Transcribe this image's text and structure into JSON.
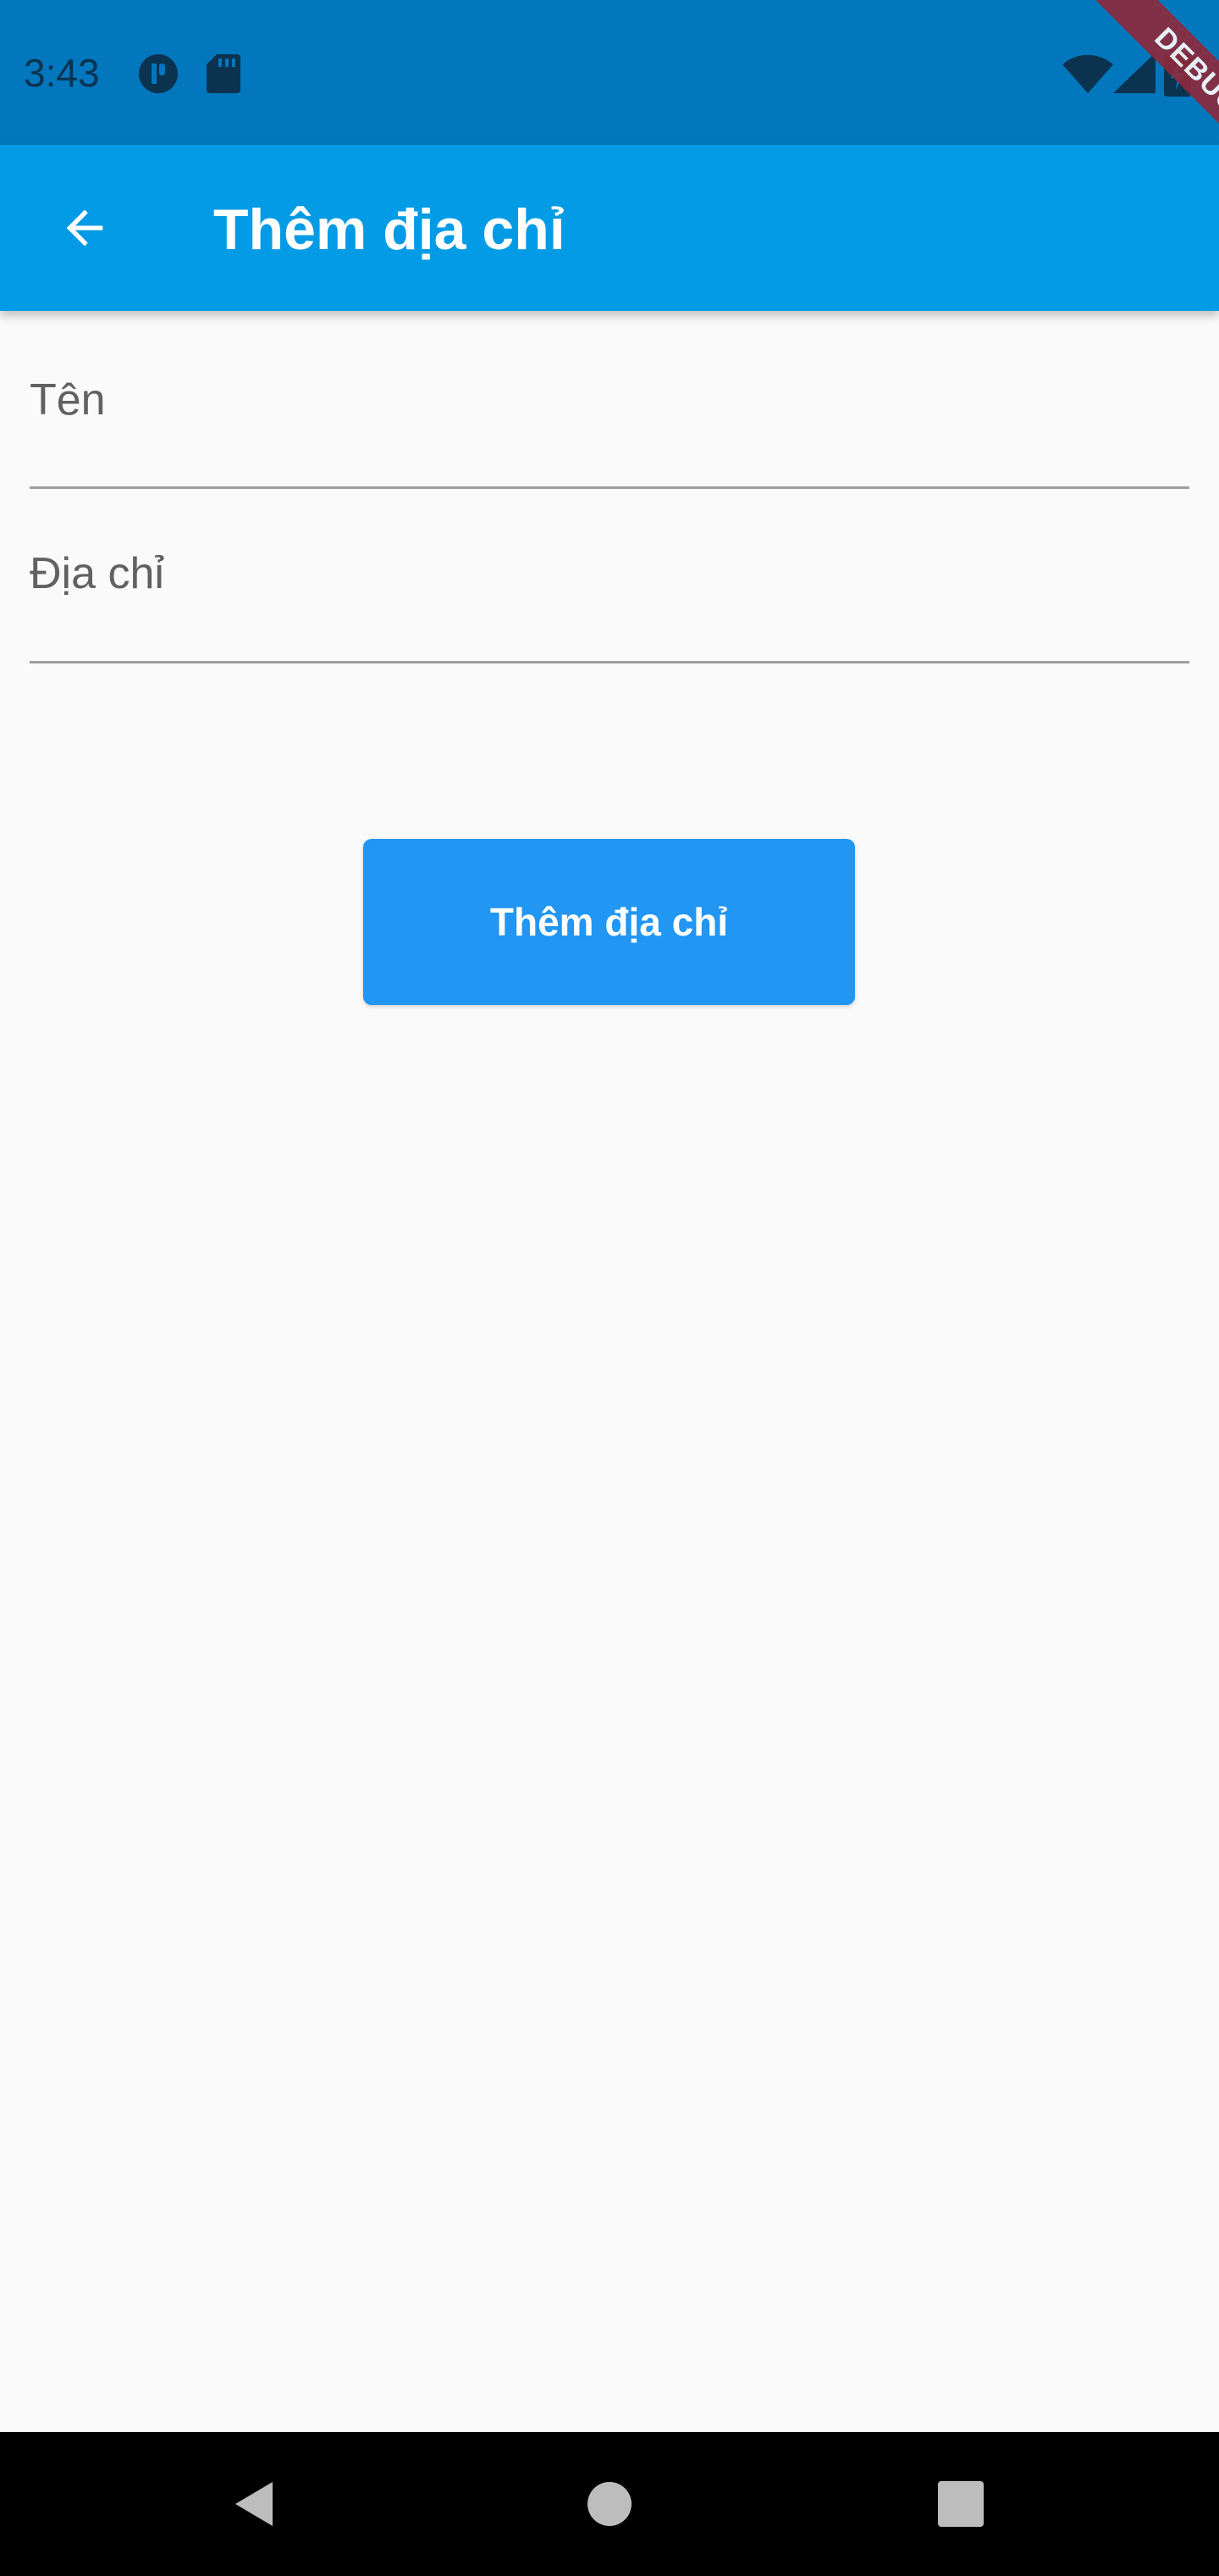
{
  "status_bar": {
    "time": "3:43",
    "icons": [
      "app-notification-icon",
      "sd-card-icon",
      "wifi-icon",
      "signal-icon",
      "battery-charging-icon"
    ]
  },
  "debug_banner": {
    "label": "DEBUG"
  },
  "app_bar": {
    "back_icon": "arrow-back-icon",
    "title": "Thêm địa chỉ"
  },
  "form": {
    "name_field": {
      "label": "Tên",
      "value": ""
    },
    "address_field": {
      "label": "Địa chỉ",
      "value": ""
    },
    "submit_label": "Thêm địa chỉ"
  },
  "nav_bar": {
    "icons": [
      "back-triangle-icon",
      "home-circle-icon",
      "recents-square-icon"
    ]
  },
  "colors": {
    "status_bar": "#0277bd",
    "app_bar": "#039be5",
    "button": "#2196f3",
    "background": "#fafafa",
    "debug_ribbon": "#8e2a3c"
  }
}
